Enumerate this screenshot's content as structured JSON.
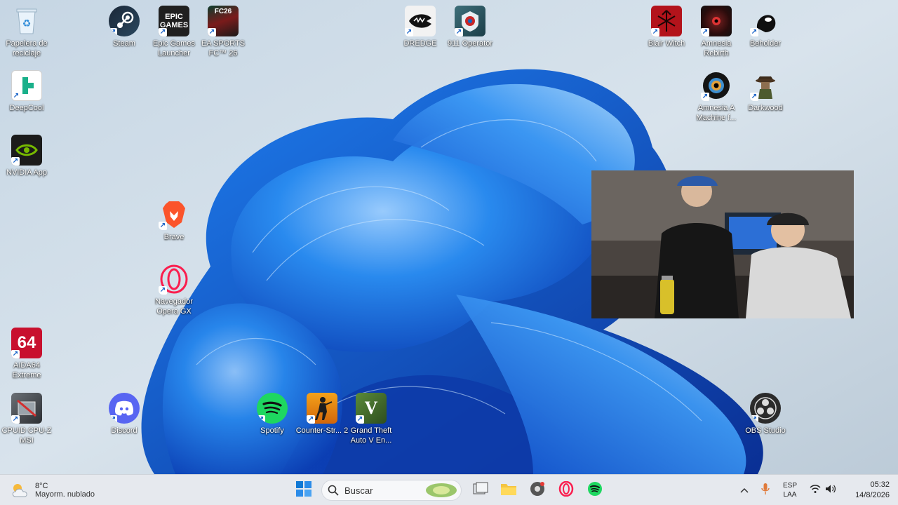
{
  "desktop": {
    "icons": [
      {
        "label": "Papelera de reciclaje",
        "icon": "recycle-bin-icon"
      },
      {
        "label": "Steam",
        "icon": "steam-icon"
      },
      {
        "label": "Epic Games Launcher",
        "icon": "epic-games-icon",
        "text": "EPIC\nGAMES"
      },
      {
        "label": "EA SPORTS FC™ 26",
        "icon": "ea-fc26-icon",
        "text": "FC26"
      },
      {
        "label": "DREDGE",
        "icon": "dredge-icon"
      },
      {
        "label": "911 Operator",
        "icon": "911-operator-icon"
      },
      {
        "label": "Blair Witch",
        "icon": "blair-witch-icon"
      },
      {
        "label": "Amnesia Rebirth",
        "icon": "amnesia-rebirth-icon"
      },
      {
        "label": "Beholder",
        "icon": "beholder-icon"
      },
      {
        "label": "DeepCool",
        "icon": "deepcool-icon"
      },
      {
        "label": "Amnesia A Machine f...",
        "icon": "amnesia-machine-icon"
      },
      {
        "label": "Darkwood",
        "icon": "darkwood-icon"
      },
      {
        "label": "NVIDIA App",
        "icon": "nvidia-icon"
      },
      {
        "label": "Brave",
        "icon": "brave-icon"
      },
      {
        "label": "Navegador Opera GX",
        "icon": "opera-gx-icon"
      },
      {
        "label": "AIDA64 Extreme",
        "icon": "aida64-icon",
        "text": "64"
      },
      {
        "label": "CPUID CPU-Z MSI",
        "icon": "cpuz-icon"
      },
      {
        "label": "Discord",
        "icon": "discord-icon"
      },
      {
        "label": "Spotify",
        "icon": "spotify-icon"
      },
      {
        "label": "Counter-Str... 2",
        "icon": "counter-strike-icon"
      },
      {
        "label": "Grand Theft Auto V En...",
        "icon": "gta-v-icon",
        "text": "V"
      },
      {
        "label": "OBS Studio",
        "icon": "obs-icon"
      }
    ]
  },
  "webcam": {
    "content": "webcam-overlay"
  },
  "taskbar": {
    "weather": {
      "temp": "8°C",
      "condition": "Mayorm. nublado",
      "icon": "cloud-sun-icon"
    },
    "start_icon": "windows-start-icon",
    "search": {
      "placeholder": "Buscar",
      "icon": "search-icon"
    },
    "pinned": [
      "widget-game-icon",
      "task-view-icon",
      "file-explorer-icon",
      "chrome-icon",
      "opera-gx-icon",
      "spotify-icon"
    ],
    "tray": {
      "chevron": "chevron-up-icon",
      "mic": "microphone-icon",
      "lang_top": "ESP",
      "lang_bottom": "LAA",
      "wifi": "wifi-icon",
      "volume": "volume-icon",
      "time": "05:32",
      "date": "14/8/2026"
    }
  }
}
